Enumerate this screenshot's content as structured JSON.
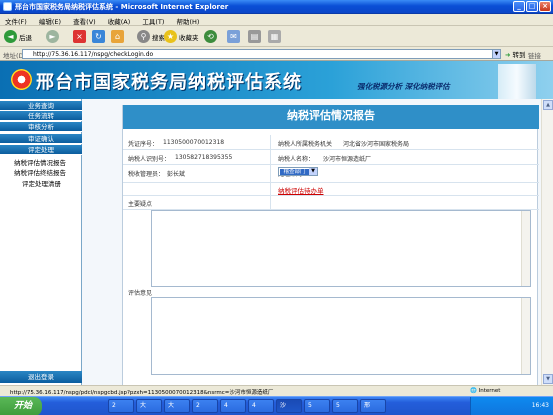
{
  "window": {
    "title": "邢台市国家税务局纳税评估系统 - Microsoft Internet Explorer"
  },
  "menu": [
    "文件(F)",
    "编辑(E)",
    "查看(V)",
    "收藏(A)",
    "工具(T)",
    "帮助(H)"
  ],
  "toolbar": {
    "back": "后退",
    "search": "搜索",
    "favorites": "收藏夹"
  },
  "address": {
    "label": "地址(D)",
    "url": "http://75.36.16.117/nspg/checkLogin.do",
    "go": "转到",
    "links": "链接"
  },
  "banner": {
    "title": "邢台市国家税务局纳税评估系统",
    "slogan": "强化税源分析  深化纳税评估"
  },
  "sidebar": {
    "items": [
      "业务查询",
      "任务流转",
      "审核分析",
      "审证确认",
      "评定处理"
    ],
    "subitems": [
      "纳税评估情况报告",
      "纳税评估终结报告",
      "评定处理清册"
    ],
    "logout": "退出登录"
  },
  "report": {
    "title": "纳税评估情况报告",
    "cert_label": "凭证序号：",
    "cert_value": "1130500070012318",
    "org_label": "纳税人所属税务机关",
    "org_value": "河北省沙河市国家税务局",
    "taxid_label": "纳税人识别号：",
    "taxid_value": "130582718395355",
    "name_label": "纳税人名称：",
    "name_value": "沙河市恒源造纸厂",
    "manager_label": "税收管理员：",
    "manager_value": "彭长斌",
    "dept_label": "处理部门",
    "dept_value": "稽查部门",
    "link": "纳税评估待办单",
    "issues_label": "主要疑点",
    "opinion_label": "评估意见"
  },
  "status": {
    "text": "http://75.36.16.117/nspg/pdcl/nspgcbd.jsp?pzxh=1130500070012318&nsrmc=沙河市恒源造纸厂",
    "zone": "Internet"
  },
  "taskbar": {
    "start": "开始",
    "tasks": [
      "2",
      "大",
      "大",
      "2",
      "4",
      "4",
      "沙",
      "5",
      "5",
      "邢"
    ],
    "clock": "16:43"
  }
}
